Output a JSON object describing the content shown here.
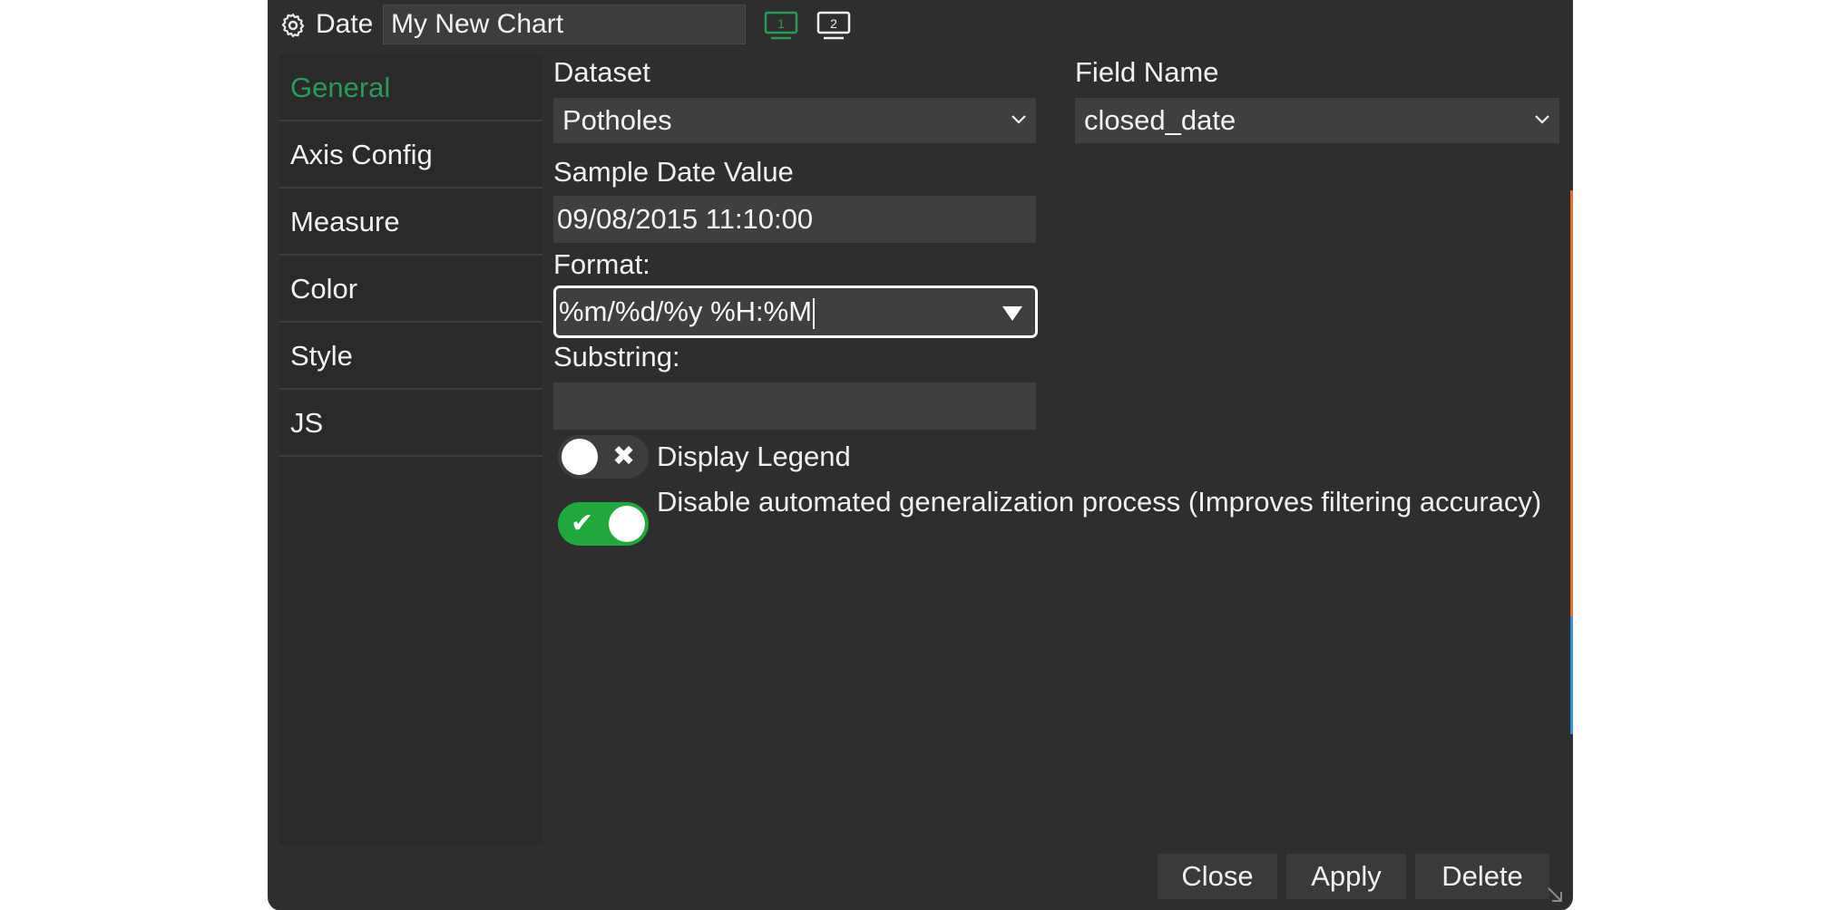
{
  "titlebar": {
    "chart_type_label": "Date",
    "chart_name": "My New Chart",
    "screen1_label": "1",
    "screen2_label": "2"
  },
  "sidebar": {
    "items": [
      {
        "label": "General",
        "active": true
      },
      {
        "label": "Axis Config"
      },
      {
        "label": "Measure"
      },
      {
        "label": "Color"
      },
      {
        "label": "Style"
      },
      {
        "label": "JS"
      }
    ]
  },
  "form": {
    "dataset_label": "Dataset",
    "dataset_value": "Potholes",
    "field_name_label": "Field Name",
    "field_name_value": "closed_date",
    "sample_date_label": "Sample Date Value",
    "sample_date_value": "09/08/2015 11:10:00",
    "format_label": "Format:",
    "format_value": "%m/%d/%y %H:%M",
    "substring_label": "Substring:",
    "substring_value": "",
    "display_legend_label": "Display Legend",
    "display_legend_on": false,
    "disable_generalization_label": "Disable automated generalization process (Improves filtering accuracy)",
    "disable_generalization_on": true
  },
  "footer": {
    "close_label": "Close",
    "apply_label": "Apply",
    "delete_label": "Delete"
  },
  "colors": {
    "accent_green": "#2a9a58",
    "toggle_on": "#21a83d",
    "panel_bg": "#2e2e2e"
  }
}
